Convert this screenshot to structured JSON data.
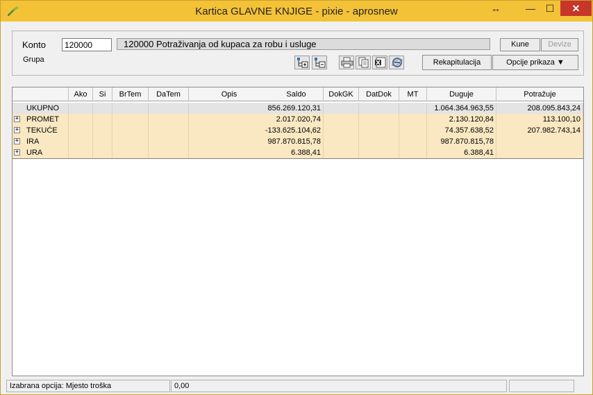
{
  "window": {
    "title": "Kartica GLAVNE KNJIGE - pixie - aprosnew",
    "resize_glyph": "↔",
    "min_glyph": "—",
    "max_glyph": "☐",
    "close_glyph": "✕"
  },
  "filter": {
    "konto_label": "Konto",
    "konto_value": "120000",
    "konto_description": "120000 Potraživanja od kupaca za robu i usluge",
    "grupa_label": "Grupa",
    "kune_label": "Kune",
    "devize_label": "Devize",
    "rekapitulacija_label": "Rekapitulacija",
    "opcije_label": "Opcije prikaza ▼"
  },
  "grid": {
    "columns": [
      "Ako",
      "Si",
      "BrTem",
      "DaTem",
      "Opis",
      "Saldo",
      "DokGK",
      "DatDok",
      "MT",
      "Duguje",
      "Potražuje"
    ],
    "rows": [
      {
        "name": "UKUPNO",
        "saldo": "856.269.120,31",
        "duguje": "1.064.364.963,55",
        "potrazuje": "208.095.843,24",
        "expander": ""
      },
      {
        "name": "PROMET",
        "saldo": "2.017.020,74",
        "duguje": "2.130.120,84",
        "potrazuje": "113.100,10",
        "expander": "+"
      },
      {
        "name": "TEKUĆE",
        "saldo": "-133.625.104,62",
        "duguje": "74.357.638,52",
        "potrazuje": "207.982.743,14",
        "expander": "+"
      },
      {
        "name": "IRA",
        "saldo": "987.870.815,78",
        "duguje": "987.870.815,78",
        "potrazuje": "",
        "expander": "+"
      },
      {
        "name": "URA",
        "saldo": "6.388,41",
        "duguje": "6.388,41",
        "potrazuje": "",
        "expander": "+"
      }
    ]
  },
  "status": {
    "option_text": "Izabrana opcija: Mjesto troška",
    "value_text": "0,00"
  },
  "colors": {
    "titlebar": "#f4c237",
    "row_highlight": "#f9e8c2",
    "close_button": "#c7352b"
  }
}
